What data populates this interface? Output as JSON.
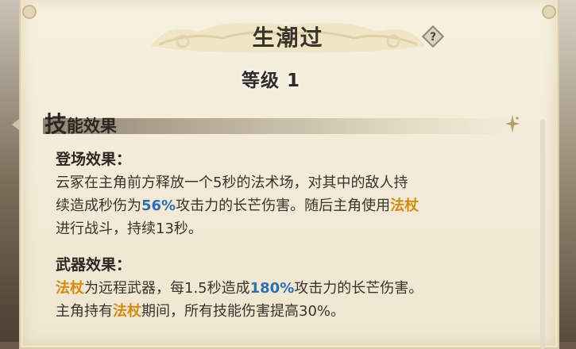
{
  "skill": {
    "title": "生潮过",
    "level": "等级 1"
  },
  "section": {
    "title_first": "技",
    "title_rest": "能效果"
  },
  "entry_effect": {
    "heading": "登场效果：",
    "line1": "云冢在主角前方释放一个5秒的法术场，对其中的敌人持",
    "line2_a": "续造成秒伤为",
    "line2_b": "56%",
    "line2_c": "攻击力的长芒伤害。随后主角使用",
    "line2_d": "法杖",
    "line3": "进行战斗，持续13秒。"
  },
  "weapon_effect": {
    "heading": "武器效果：",
    "line1_a": "法杖",
    "line1_b": "为远程武器，每1.5秒造成",
    "line1_c": "180%",
    "line1_d": "攻击力的长芒伤害。",
    "line2_a": "主角持有",
    "line2_b": "法杖",
    "line2_c": "期间，所有技能伤害提高30%。"
  },
  "colors": {
    "highlight_gold": "#d08b10",
    "highlight_blue": "#2e6fb0",
    "parchment": "#f3ecd9"
  },
  "icons": {
    "help": "question-diamond-icon",
    "sparkle": "sparkle-icon"
  }
}
